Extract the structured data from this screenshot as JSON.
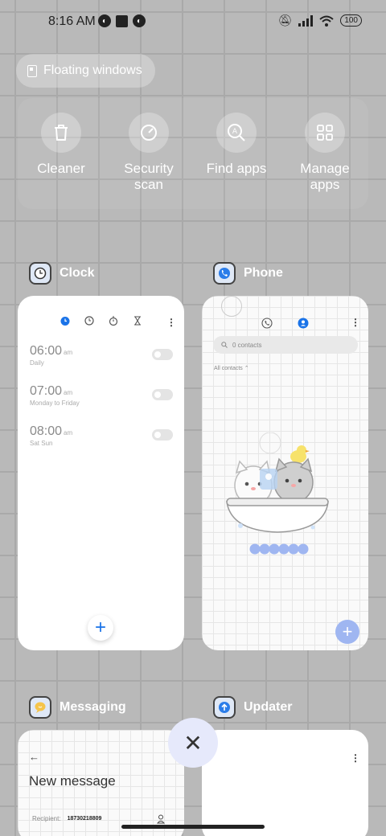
{
  "status": {
    "time": "8:16 AM",
    "battery": "100"
  },
  "floating_windows": {
    "label": "Floating windows"
  },
  "quick_actions": [
    {
      "label": "Cleaner",
      "icon": "trash-icon"
    },
    {
      "label": "Security\nscan",
      "icon": "security-scan-icon"
    },
    {
      "label": "Find apps",
      "icon": "search-apps-icon"
    },
    {
      "label": "Manage\napps",
      "icon": "grid-icon"
    }
  ],
  "apps": {
    "clock": {
      "name": "Clock",
      "alarms": [
        {
          "time": "06:00",
          "ampm": "am",
          "repeat": "Daily"
        },
        {
          "time": "07:00",
          "ampm": "am",
          "repeat": "Monday to Friday"
        },
        {
          "time": "08:00",
          "ampm": "am",
          "repeat": "Sat Sun"
        }
      ],
      "fab": "+"
    },
    "phone": {
      "name": "Phone",
      "search_placeholder": "0 contacts",
      "filter": "All contacts",
      "fab": "+"
    },
    "messaging": {
      "name": "Messaging",
      "back": "←",
      "title": "New message",
      "recipient_label": "Recipient:",
      "recipient_value": "18730218809"
    },
    "updater": {
      "name": "Updater"
    }
  },
  "close_button": "✕",
  "colors": {
    "accent": "#1a73e8",
    "close_bg": "#e6e9fb",
    "overlay": "#b9b9b9"
  }
}
